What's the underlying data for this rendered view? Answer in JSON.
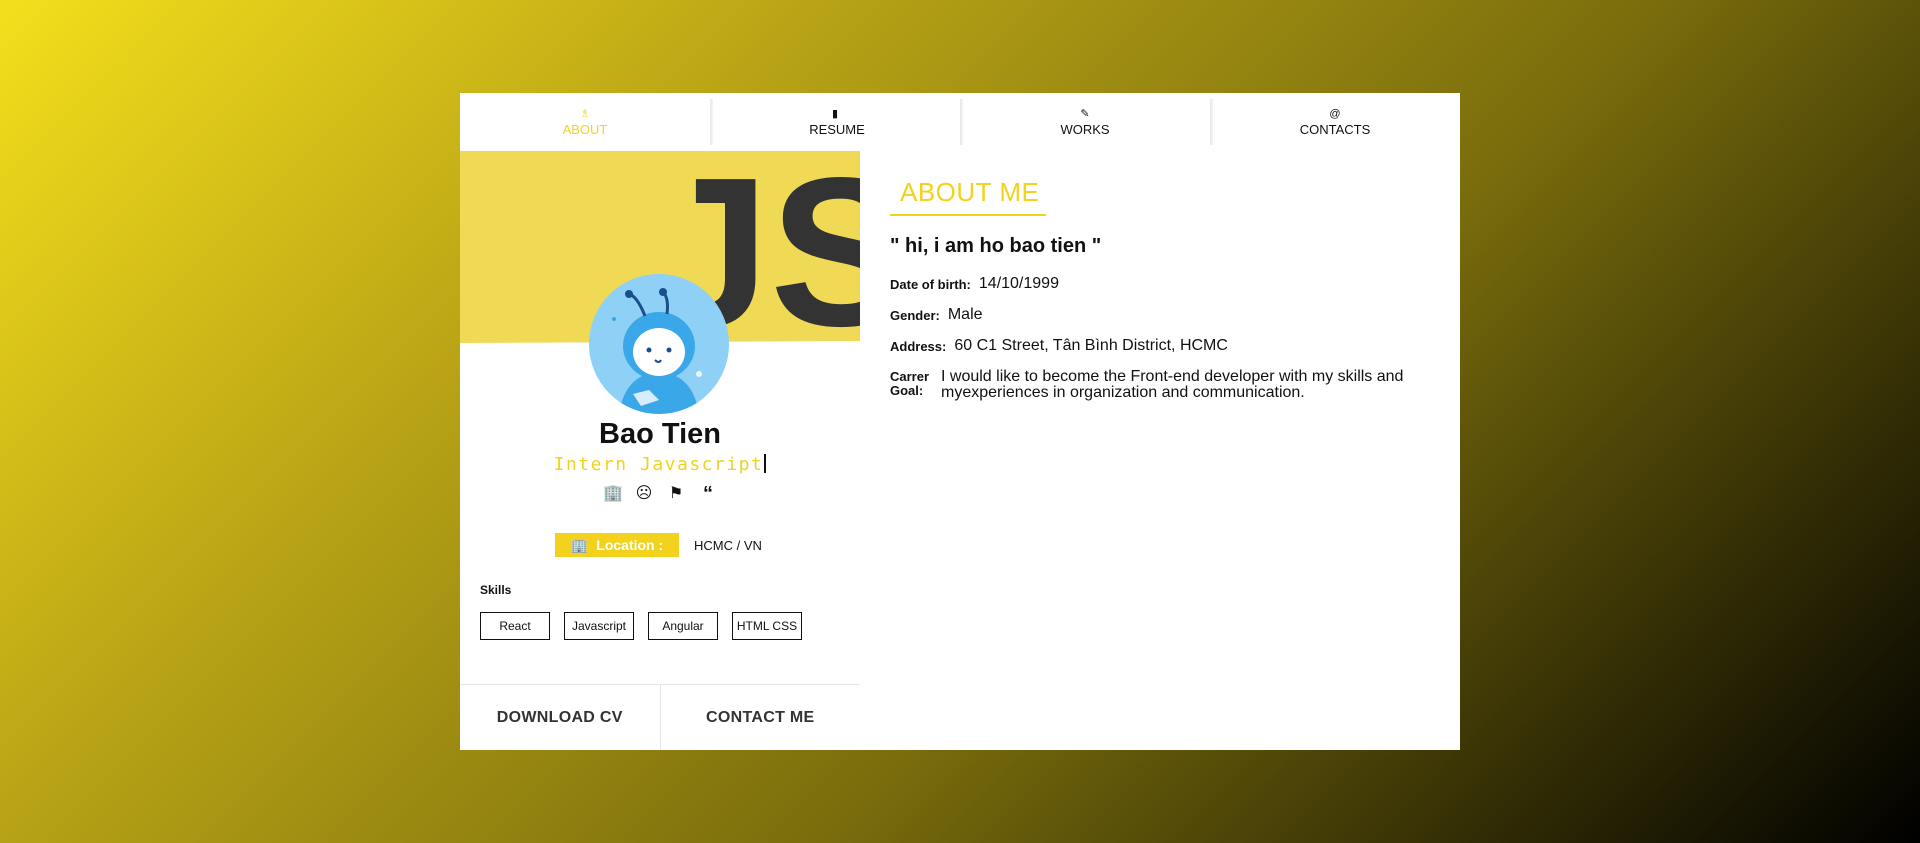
{
  "colors": {
    "accent": "#f2d21c",
    "banner": "#f0da55",
    "js_dark": "#333333",
    "avatar_bg": "#8fd0f7"
  },
  "tabs": [
    {
      "label": "ABOUT",
      "icon": "user-icon",
      "active": true
    },
    {
      "label": "RESUME",
      "icon": "book-icon",
      "active": false
    },
    {
      "label": "WORKS",
      "icon": "pencil-icon",
      "active": false
    },
    {
      "label": "CONTACTS",
      "icon": "at-icon",
      "active": false
    }
  ],
  "profile": {
    "banner_text": "JS",
    "name": "Bao Tien",
    "role": "Intern Javascript",
    "socials": [
      "building-icon",
      "face-icon",
      "flag-icon",
      "quote-icon"
    ],
    "location_label": "Location :",
    "location_value": "HCMC / VN",
    "skills_title": "Skills",
    "skills": [
      "React",
      "Javascript",
      "Angular",
      "HTML CSS"
    ],
    "download_label": "DOWNLOAD CV",
    "contact_label": "CONTACT ME"
  },
  "about": {
    "title": "ABOUT ME",
    "quote": "\" hi, i am ho bao tien \"",
    "dob_label": "Date of birth:",
    "dob_value": "14/10/1999",
    "gender_label": "Gender:",
    "gender_value": "Male",
    "address_label": "Address:",
    "address_value": "60 C1 Street, Tân Bình District, HCMC",
    "goal_label": "Carrer Goal:",
    "goal_value": "I would like to become the Front-end developer with my skills and myexperiences in organization and communication."
  }
}
